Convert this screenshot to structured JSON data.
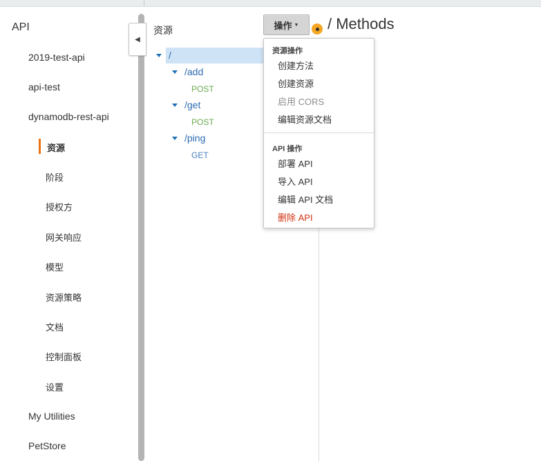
{
  "sidebar": {
    "root": "API",
    "apis": [
      "2019-test-api",
      "api-test",
      "dynamodb-rest-api"
    ],
    "sub_items": [
      "资源",
      "阶段",
      "授权方",
      "网关响应",
      "模型",
      "资源策略",
      "文档",
      "控制面板",
      "设置"
    ],
    "active_item": "资源",
    "bottom_items": [
      "My Utilities",
      "PetStore"
    ]
  },
  "resources": {
    "title": "资源",
    "actions_label": "操作",
    "tree": [
      {
        "path": "/",
        "selected": true,
        "methods": []
      },
      {
        "path": "/add",
        "methods": [
          "POST"
        ]
      },
      {
        "path": "/get",
        "methods": [
          "POST"
        ]
      },
      {
        "path": "/ping",
        "methods": [
          "GET"
        ]
      }
    ]
  },
  "methods_header": "/ Methods",
  "actions_menu": {
    "resource_section": "资源操作",
    "resource_items": [
      "创建方法",
      "创建资源",
      "启用 CORS",
      "编辑资源文档"
    ],
    "api_section": "API 操作",
    "api_items": [
      "部署 API",
      "导入 API",
      "编辑 API 文档",
      "删除 API"
    ]
  },
  "colors": {
    "accent": "#ec7211",
    "link": "#2d6bb3",
    "post": "#6aa84f",
    "danger": "#d13212",
    "selected_row": "#cfe3f6"
  },
  "icons": [
    "collapse-chevron-left-icon",
    "caret-down-icon",
    "expand-triangle-icon",
    "orange-dot-icon"
  ]
}
